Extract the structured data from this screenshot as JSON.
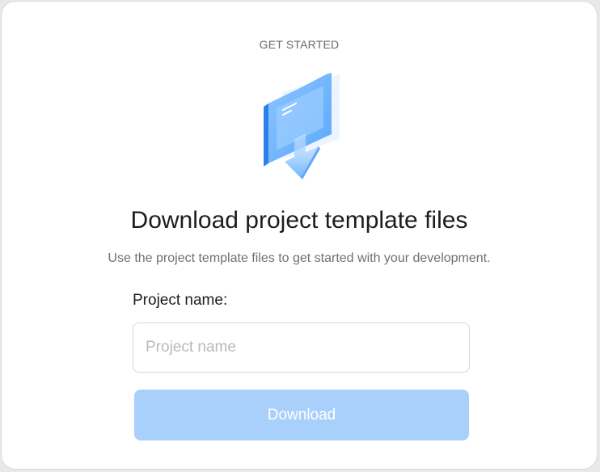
{
  "header": {
    "eyebrow": "GET STARTED",
    "title": "Download project template files",
    "subtitle": "Use the project template files to get started with your development."
  },
  "illustration": {
    "icon": "monitor-download-icon"
  },
  "form": {
    "project_name_label": "Project name:",
    "project_name_placeholder": "Project name",
    "project_name_value": "",
    "download_label": "Download",
    "download_disabled": true
  },
  "colors": {
    "accent": "#3d8ef7",
    "button_disabled": "#a9d0fb",
    "title": "#1d1d1f",
    "muted": "#707070"
  }
}
